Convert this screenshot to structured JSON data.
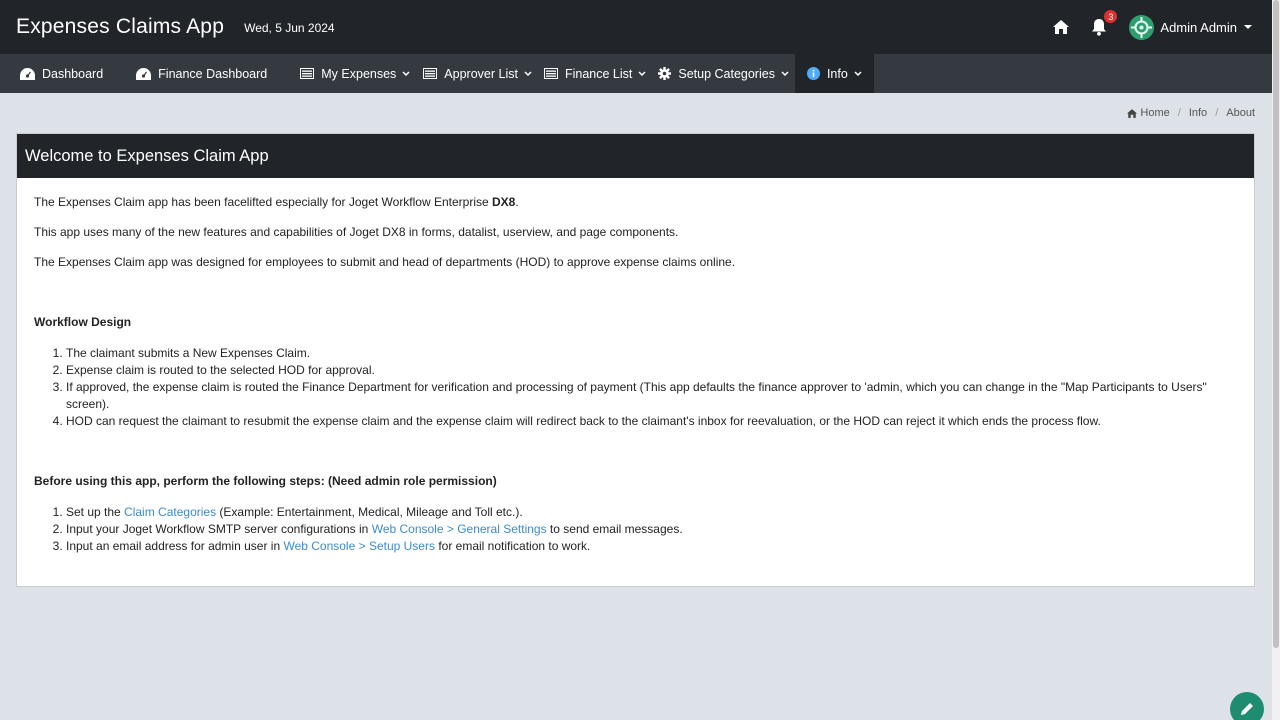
{
  "header": {
    "app_title": "Expenses Claims App",
    "date": "Wed, 5 Jun 2024",
    "notification_count": "3",
    "user_name": "Admin Admin"
  },
  "nav": {
    "items": [
      {
        "label": "Dashboard",
        "icon": "dashboard-icon",
        "has_dropdown": false
      },
      {
        "label": "Finance Dashboard",
        "icon": "dashboard-icon",
        "has_dropdown": false
      },
      {
        "label": "My Expenses",
        "icon": "list-icon",
        "has_dropdown": true
      },
      {
        "label": "Approver List",
        "icon": "list-icon",
        "has_dropdown": true
      },
      {
        "label": "Finance List",
        "icon": "list-icon",
        "has_dropdown": true
      },
      {
        "label": "Setup Categories",
        "icon": "gear-icon",
        "has_dropdown": true
      },
      {
        "label": "Info",
        "icon": "info-icon",
        "has_dropdown": true,
        "active": true
      }
    ]
  },
  "breadcrumb": {
    "home": "Home",
    "info": "Info",
    "about": "About"
  },
  "card": {
    "title": "Welcome to Expenses Claim App",
    "intro_1_prefix": "The Expenses Claim app has been facelifted especially for Joget Workflow Enterprise ",
    "intro_1_bold": "DX8",
    "intro_1_suffix": ".",
    "intro_2": "This app uses many of the new features and capabilities of Joget DX8 in forms, datalist, userview, and page components.",
    "intro_3": "The Expenses Claim app was designed for employees to submit and head of departments (HOD) to approve expense claims online.",
    "workflow_heading": "Workflow Design",
    "workflow_steps": [
      "The claimant submits a New Expenses Claim.",
      "Expense claim is routed to the selected HOD for approval.",
      "If approved, the expense claim is routed the Finance Department for verification and processing of payment (This app defaults the finance approver to 'admin, which you can change in the \"Map Participants to Users\" screen).",
      "HOD can request the claimant to resubmit the expense claim and the expense claim will redirect back to the claimant's inbox for reevaluation, or the HOD can reject it which ends the process flow."
    ],
    "steps_heading": "Before using this app, perform the following steps: (Need admin role permission)",
    "setup_step_1_prefix": "Set up the ",
    "setup_step_1_link": "Claim Categories",
    "setup_step_1_suffix": " (Example: Entertainment, Medical, Mileage and Toll etc.).",
    "setup_step_2_prefix": "Input your Joget Workflow SMTP server configurations in ",
    "setup_step_2_link": "Web Console > General Settings",
    "setup_step_2_suffix": " to send email messages.",
    "setup_step_3_prefix": "Input an email address for admin user in ",
    "setup_step_3_link": "Web Console > Setup Users",
    "setup_step_3_suffix": " for email notification to work."
  },
  "colors": {
    "topbar": "#212529",
    "navbar": "#343a40",
    "link": "#3b8bd0",
    "badge": "#e03131",
    "fab": "#1e8c6e"
  },
  "fab": {
    "icon": "pencil-icon"
  }
}
